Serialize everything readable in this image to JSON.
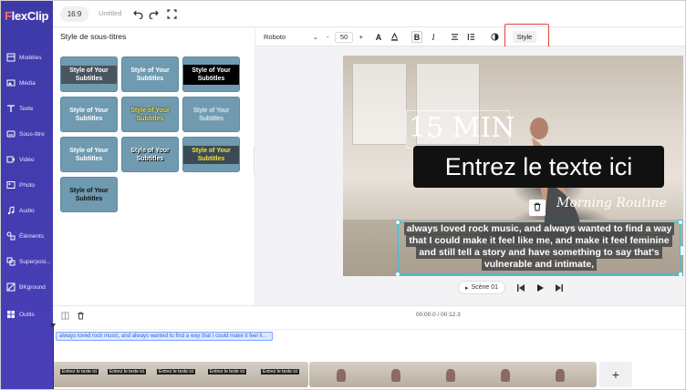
{
  "app": {
    "logo_prefix": "F",
    "logo_rest": "lexClip"
  },
  "topbar": {
    "ratio": "16:9",
    "title": "Untitled"
  },
  "nav": {
    "items": [
      {
        "label": "Modèles",
        "icon": "templates-icon"
      },
      {
        "label": "Média",
        "icon": "media-icon"
      },
      {
        "label": "Texte",
        "icon": "text-icon"
      },
      {
        "label": "Sous-titre",
        "icon": "subtitle-icon"
      },
      {
        "label": "Vidéo",
        "icon": "video-icon"
      },
      {
        "label": "Photo",
        "icon": "photo-icon"
      },
      {
        "label": "Audio",
        "icon": "audio-icon"
      },
      {
        "label": "Éléments",
        "icon": "elements-icon"
      },
      {
        "label": "Superposi...",
        "icon": "overlay-icon"
      },
      {
        "label": "BKground",
        "icon": "background-icon"
      },
      {
        "label": "Outils",
        "icon": "tools-icon"
      }
    ]
  },
  "panel": {
    "title": "Style de sous-titres",
    "tiles": [
      {
        "text": "Style of Your Subtitles"
      },
      {
        "text": "Style of Your Subtitles"
      },
      {
        "text": "Style of Your Subtitles"
      },
      {
        "text": "Style of Your Subtitles"
      },
      {
        "text": "Style of Your Subtitles"
      },
      {
        "text": "Style of Your Subtitles"
      },
      {
        "text": "Style of Your Subtitles"
      },
      {
        "text": "Style of Your Subtitles"
      },
      {
        "text": "Style of Your Subtitles"
      },
      {
        "text": "Style of Your Subtitles"
      }
    ]
  },
  "texttoolbar": {
    "font": "Roboto",
    "size": "50",
    "minus": "-",
    "plus": "+",
    "style_label": "Style"
  },
  "canvas": {
    "min_text": "15 MIN",
    "headline": "Entrez le texte ici",
    "tagline": "Morning Routine",
    "subtitle_lines": [
      "always loved rock music, and always wanted to find a way",
      "that I could make it feel like me, and make it feel feminine",
      "and still tell a story and have something to say that's",
      "vulnerable and intimate,"
    ]
  },
  "playback": {
    "scene_label": "Scène 01"
  },
  "timeline": {
    "time": "00:00.0 / 00:12.3",
    "subtitle_clip": "always loved rock music, and always wanted to find a way that I could make it feel li...",
    "clip_caption": "Entrez le texte ici",
    "add_label": "+"
  },
  "colors": {
    "nav_bg": "#3d3aa8",
    "accent": "#3dbfd9",
    "highlight": "#e0443a",
    "tile_bg": "#6f9ab0"
  }
}
